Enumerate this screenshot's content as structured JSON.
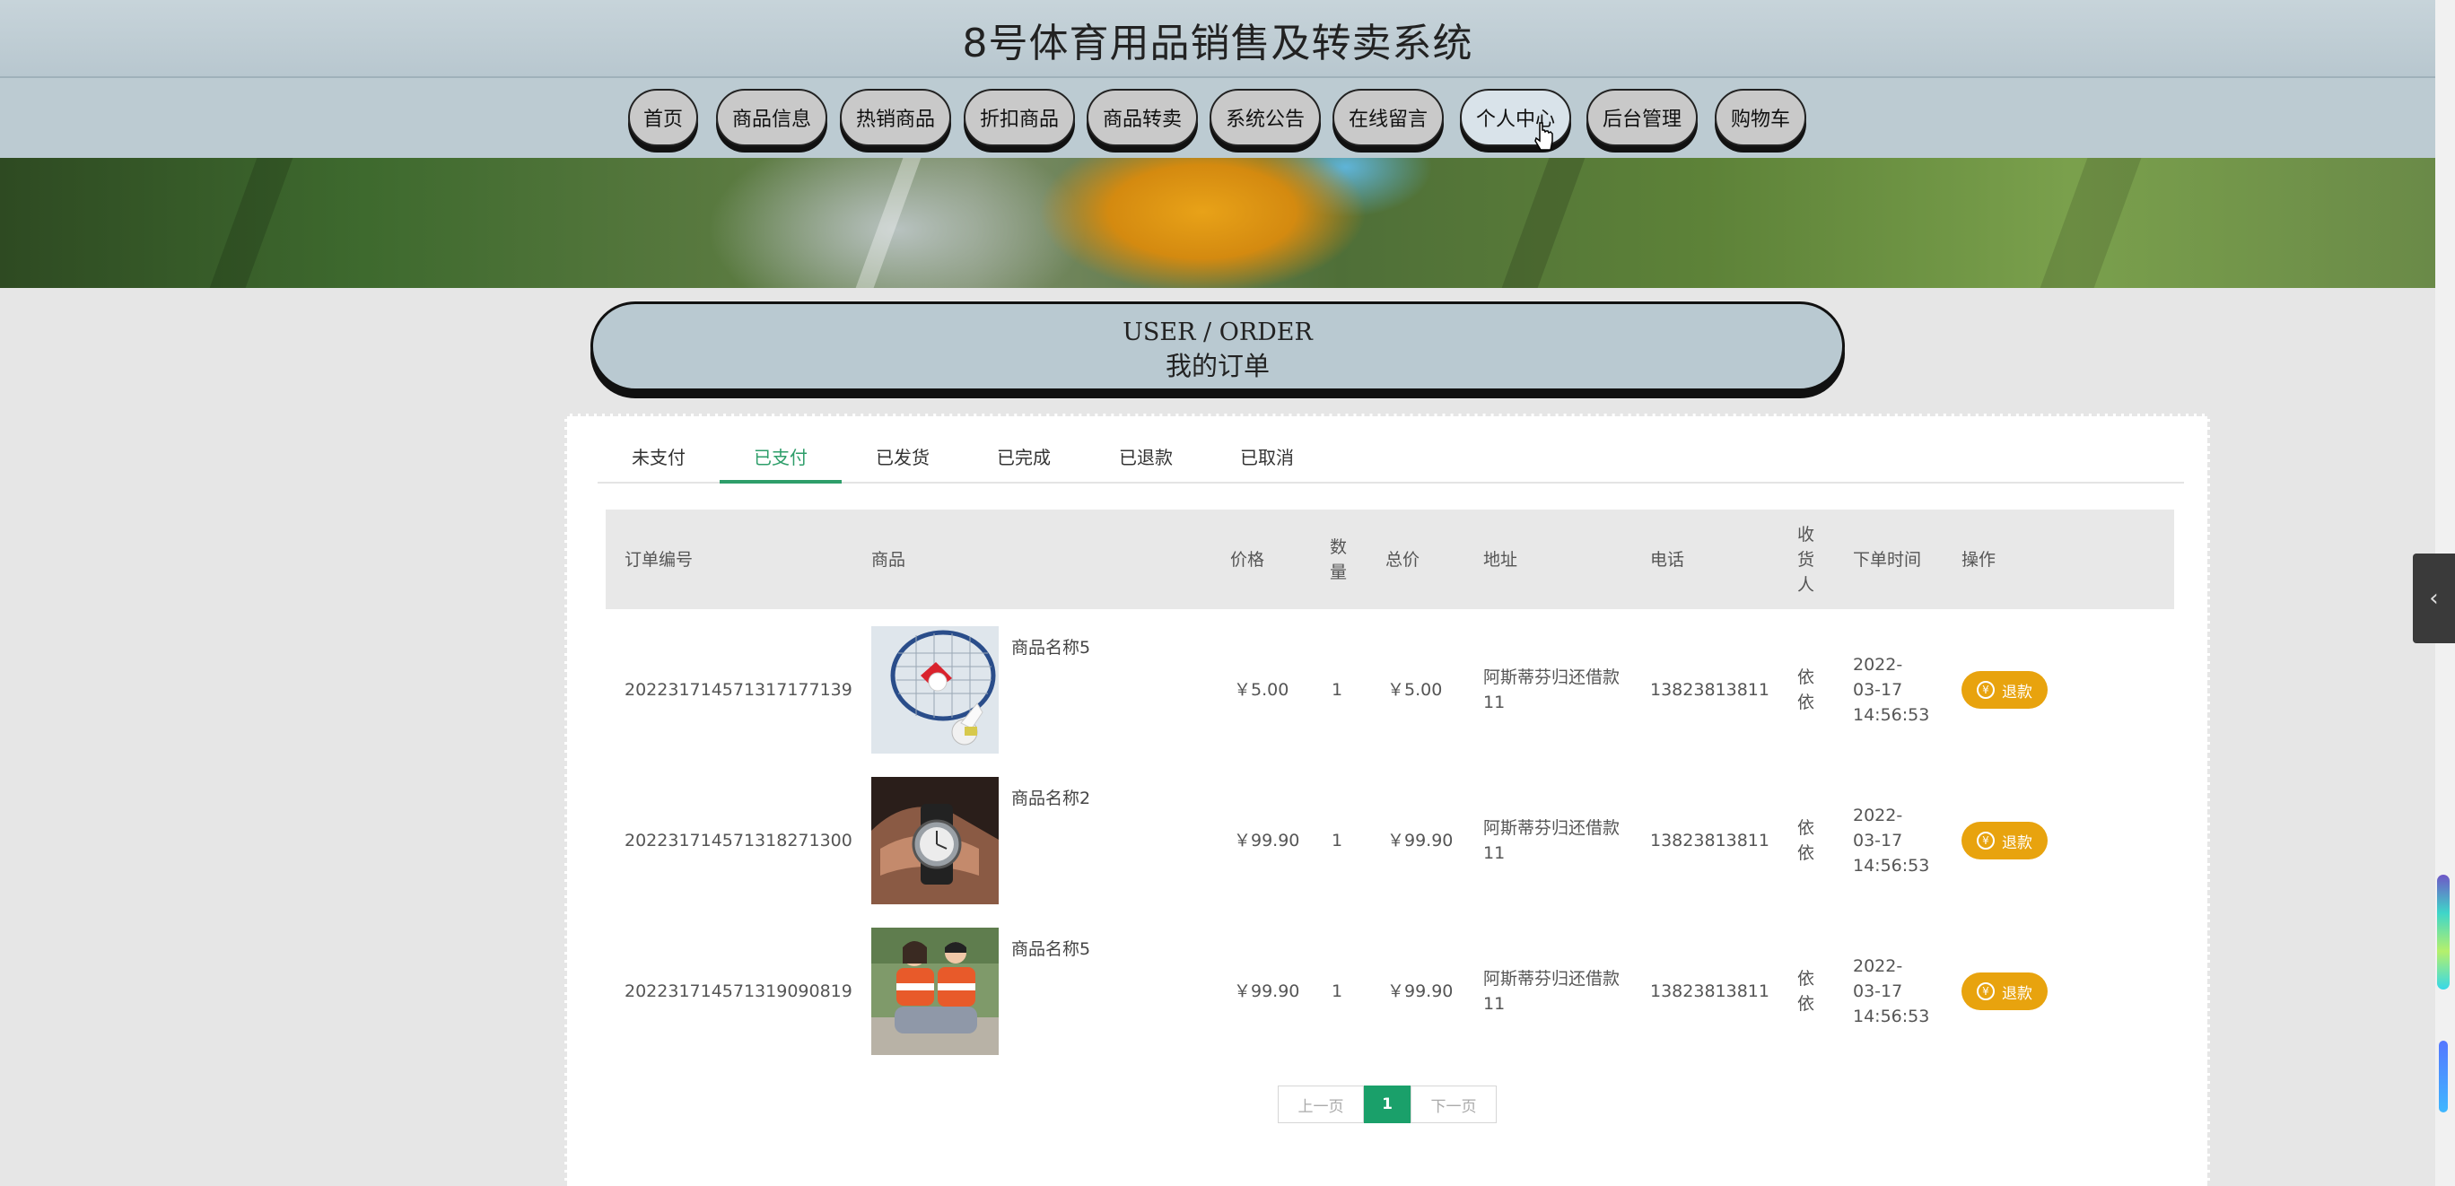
{
  "header": {
    "title": "8号体育用品销售及转卖系统"
  },
  "nav": {
    "items": [
      {
        "label": "首页"
      },
      {
        "label": "商品信息"
      },
      {
        "label": "热销商品"
      },
      {
        "label": "折扣商品"
      },
      {
        "label": "商品转卖"
      },
      {
        "label": "系统公告"
      },
      {
        "label": "在线留言"
      },
      {
        "label": "个人中心"
      },
      {
        "label": "后台管理"
      },
      {
        "label": "购物车"
      }
    ],
    "active": "个人中心"
  },
  "section": {
    "title_en": "USER / ORDER",
    "title_zh": "我的订单"
  },
  "tabs": [
    {
      "label": "未支付"
    },
    {
      "label": "已支付"
    },
    {
      "label": "已发货"
    },
    {
      "label": "已完成"
    },
    {
      "label": "已退款"
    },
    {
      "label": "已取消"
    }
  ],
  "active_tab": "已支付",
  "table": {
    "columns": [
      "订单编号",
      "商品",
      "价格",
      "数量",
      "总价",
      "地址",
      "电话",
      "收货人",
      "下单时间",
      "操作"
    ],
    "rows": [
      {
        "order_no": "20223171457131717713​9",
        "product": "商品名称5",
        "price": "￥5.00",
        "qty": "1",
        "total": "￥5.00",
        "address": "阿斯蒂芬归还借款11",
        "phone": "13823813811",
        "receiver": "依依",
        "time": "2022-03-17 14:56:53",
        "action": "退款",
        "image": "badminton"
      },
      {
        "order_no": "202231714571318271300",
        "product": "商品名称2",
        "price": "￥99.90",
        "qty": "1",
        "total": "￥99.90",
        "address": "阿斯蒂芬归还借款11",
        "phone": "13823813811",
        "receiver": "依依",
        "time": "2022-03-17 14:56:53",
        "action": "退款",
        "image": "watch"
      },
      {
        "order_no": "202231714571319090819",
        "product": "商品名称5",
        "price": "￥99.90",
        "qty": "1",
        "total": "￥99.90",
        "address": "阿斯蒂芬归还借款11",
        "phone": "13823813811",
        "receiver": "依依",
        "time": "2022-03-17 14:56:53",
        "action": "退款",
        "image": "couple"
      }
    ]
  },
  "pagination": {
    "prev": "上一页",
    "current": "1",
    "next": "下一页"
  },
  "colors": {
    "accent_green": "#2e9e6a",
    "refund_orange": "#e8a30e",
    "header_blue": "#b9c9d1"
  }
}
